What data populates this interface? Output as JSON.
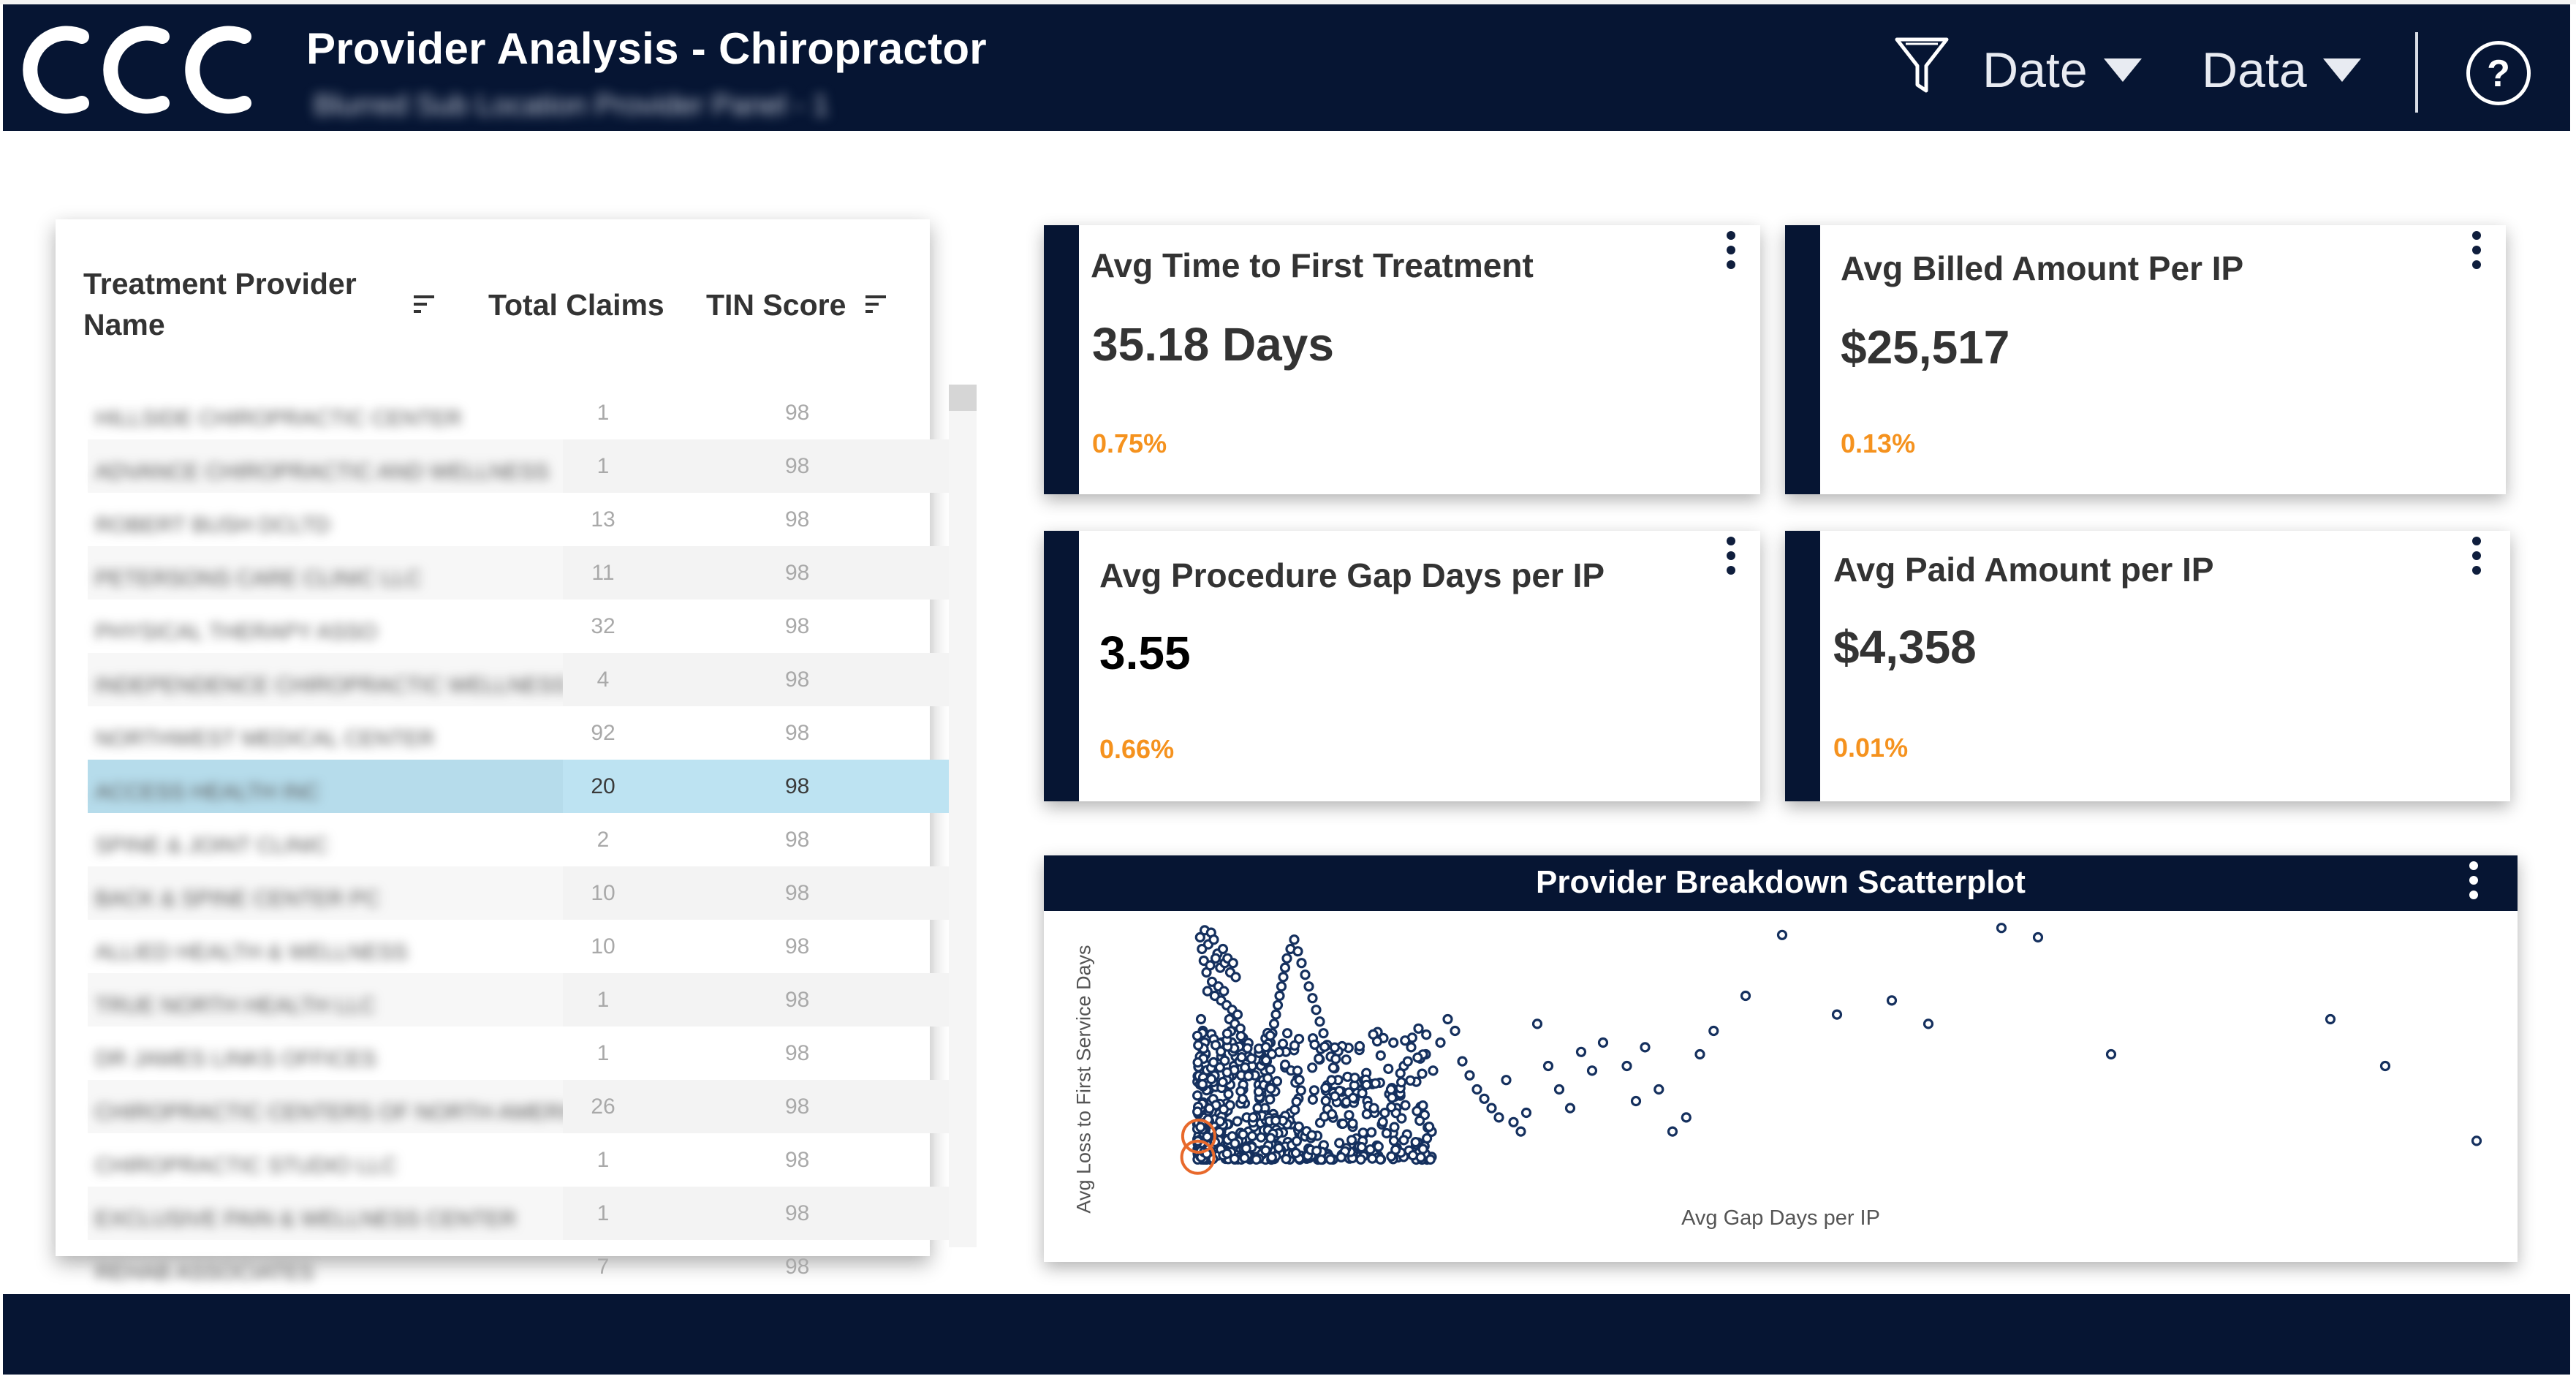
{
  "header": {
    "title": "Provider Analysis - Chiropractor",
    "subtitle": "Blurred Sub Location Provider Panel - 1",
    "date_label": "Date",
    "data_label": "Data",
    "help_label": "?"
  },
  "table": {
    "col_name": [
      "Treatment Provider",
      "Name"
    ],
    "col_claims": "Total Claims",
    "col_tin": "TIN Score",
    "rows": [
      {
        "name": "HILLSIDE CHIROPRACTIC CENTER",
        "claims": "1",
        "tin": "98"
      },
      {
        "name": "ADVANCE CHIROPRACTIC AND WELLNESS",
        "claims": "1",
        "tin": "98"
      },
      {
        "name": "ROBERT BUSH DCLTD",
        "claims": "13",
        "tin": "98"
      },
      {
        "name": "PETERSONS CARE CLINIC LLC",
        "claims": "11",
        "tin": "98"
      },
      {
        "name": "PHYSICAL THERAPY ASSO",
        "claims": "32",
        "tin": "98"
      },
      {
        "name": "INDEPENDENCE CHIROPRACTIC WELLNESS",
        "claims": "4",
        "tin": "98"
      },
      {
        "name": "NORTHWEST MEDICAL CENTER",
        "claims": "92",
        "tin": "98"
      },
      {
        "name": "ACCESS HEALTH INC",
        "claims": "20",
        "tin": "98"
      },
      {
        "name": "SPINE & JOINT CLINIC",
        "claims": "2",
        "tin": "98"
      },
      {
        "name": "BACK & SPINE CENTER PC",
        "claims": "10",
        "tin": "98"
      },
      {
        "name": "ALLIED HEALTH & WELLNESS",
        "claims": "10",
        "tin": "98"
      },
      {
        "name": "TRUE NORTH HEALTH LLC",
        "claims": "1",
        "tin": "98"
      },
      {
        "name": "DR JAMES LINKS OFFICES",
        "claims": "1",
        "tin": "98"
      },
      {
        "name": "CHIROPRACTIC CENTERS OF NORTH AMERICA INC",
        "claims": "26",
        "tin": "98"
      },
      {
        "name": "CHIROPRACTIC STUDIO LLC",
        "claims": "1",
        "tin": "98"
      },
      {
        "name": "EXCLUSIVE PAIN & WELLNESS CENTER",
        "claims": "1",
        "tin": "98"
      },
      {
        "name": "REHAB ASSOCIATES",
        "claims": "7",
        "tin": "98"
      }
    ]
  },
  "kpis": [
    {
      "title": "Avg Time to First Treatment",
      "value": "35.18 Days",
      "delta": "0.75%"
    },
    {
      "title": "Avg Billed Amount Per IP",
      "value": "$25,517",
      "delta": "0.13%"
    },
    {
      "title": "Avg Procedure Gap Days per IP",
      "value": "3.55",
      "delta": "0.66%"
    },
    {
      "title": "Avg Paid Amount per IP",
      "value": "$4,358",
      "delta": "0.01%"
    }
  ],
  "chart_data": {
    "type": "scatter",
    "title": "Provider Breakdown Scatterplot",
    "xlabel": "Avg Gap Days per IP",
    "ylabel": "Avg Loss to First Service Days",
    "xlim": [
      0,
      100
    ],
    "ylim": [
      0,
      100
    ],
    "grid": false,
    "colors": {
      "points": "#15305e",
      "highlight": "#e8692b"
    },
    "highlighted": [
      [
        0.5,
        1
      ],
      [
        1.5,
        10
      ]
    ],
    "points": [
      [
        3,
        95
      ],
      [
        8,
        98
      ],
      [
        12,
        92
      ],
      [
        5,
        90
      ],
      [
        15,
        97
      ],
      [
        18,
        94
      ],
      [
        22,
        88
      ],
      [
        7,
        85
      ],
      [
        10,
        80
      ],
      [
        14,
        83
      ],
      [
        20,
        86
      ],
      [
        25,
        82
      ],
      [
        28,
        90
      ],
      [
        30,
        84
      ],
      [
        33,
        86
      ],
      [
        36,
        80
      ],
      [
        39,
        84
      ],
      [
        42,
        78
      ],
      [
        11,
        72
      ],
      [
        16,
        76
      ],
      [
        19,
        70
      ],
      [
        23,
        74
      ],
      [
        26,
        68
      ],
      [
        29,
        72
      ],
      [
        32,
        66
      ],
      [
        35,
        60
      ],
      [
        38,
        64
      ],
      [
        41,
        58
      ],
      [
        44,
        62
      ],
      [
        47,
        56
      ],
      [
        50,
        52
      ],
      [
        53,
        48
      ],
      [
        56,
        44
      ],
      [
        60,
        40
      ],
      [
        63,
        36
      ],
      [
        67,
        32
      ],
      [
        70,
        28
      ],
      [
        74,
        22
      ],
      [
        77,
        18
      ],
      [
        81,
        14
      ],
      [
        85,
        10
      ],
      [
        88,
        6
      ],
      [
        4,
        60
      ],
      [
        6,
        55
      ],
      [
        8,
        50
      ],
      [
        9,
        45
      ],
      [
        10,
        40
      ],
      [
        12,
        35
      ],
      [
        13,
        30
      ],
      [
        15,
        25
      ],
      [
        17,
        20
      ],
      [
        18,
        15
      ],
      [
        20,
        10
      ],
      [
        22,
        5
      ],
      [
        24,
        8
      ],
      [
        26,
        12
      ],
      [
        28,
        16
      ],
      [
        30,
        20
      ],
      [
        32,
        24
      ],
      [
        34,
        28
      ],
      [
        36,
        32
      ],
      [
        38,
        36
      ],
      [
        40,
        40
      ],
      [
        42,
        44
      ],
      [
        44,
        48
      ],
      [
        46,
        42
      ],
      [
        48,
        36
      ],
      [
        50,
        30
      ],
      [
        52,
        24
      ],
      [
        54,
        18
      ],
      [
        56,
        12
      ],
      [
        58,
        6
      ],
      [
        60,
        10
      ],
      [
        62,
        14
      ],
      [
        64,
        18
      ],
      [
        66,
        22
      ],
      [
        68,
        26
      ],
      [
        70,
        30
      ],
      [
        72,
        34
      ],
      [
        74,
        38
      ],
      [
        76,
        42
      ],
      [
        78,
        46
      ],
      [
        80,
        50
      ],
      [
        82,
        54
      ],
      [
        84,
        58
      ],
      [
        86,
        62
      ],
      [
        88,
        66
      ],
      [
        90,
        70
      ],
      [
        92,
        74
      ],
      [
        94,
        78
      ],
      [
        96,
        82
      ],
      [
        98,
        86
      ],
      [
        102,
        90
      ],
      [
        106,
        94
      ],
      [
        110,
        89
      ],
      [
        114,
        84
      ],
      [
        118,
        79
      ],
      [
        122,
        74
      ],
      [
        126,
        69
      ],
      [
        130,
        64
      ],
      [
        134,
        59
      ],
      [
        138,
        54
      ],
      [
        142,
        49
      ],
      [
        146,
        44
      ],
      [
        150,
        39
      ],
      [
        154,
        34
      ],
      [
        158,
        29
      ],
      [
        162,
        24
      ],
      [
        166,
        19
      ],
      [
        170,
        14
      ],
      [
        174,
        9
      ],
      [
        180,
        30
      ],
      [
        186,
        25
      ],
      [
        194,
        20
      ],
      [
        202,
        15
      ],
      [
        210,
        28
      ],
      [
        218,
        22
      ],
      [
        226,
        40
      ],
      [
        234,
        48
      ],
      [
        242,
        56
      ],
      [
        250,
        45
      ],
      [
        258,
        38
      ],
      [
        266,
        50
      ],
      [
        274,
        60
      ],
      [
        282,
        55
      ],
      [
        290,
        42
      ],
      [
        298,
        36
      ],
      [
        306,
        30
      ],
      [
        314,
        26
      ],
      [
        322,
        22
      ],
      [
        330,
        18
      ],
      [
        338,
        34
      ],
      [
        346,
        16
      ],
      [
        354,
        12
      ],
      [
        360,
        20
      ],
      [
        372,
        58
      ],
      [
        384,
        40
      ],
      [
        396,
        30
      ],
      [
        408,
        22
      ],
      [
        420,
        46
      ],
      [
        432,
        38
      ],
      [
        444,
        50
      ],
      [
        470,
        40
      ],
      [
        480,
        25
      ],
      [
        490,
        48
      ],
      [
        505,
        30
      ],
      [
        520,
        12
      ],
      [
        535,
        18
      ],
      [
        550,
        45
      ],
      [
        565,
        55
      ],
      [
        600,
        70
      ],
      [
        640,
        96
      ],
      [
        700,
        62
      ],
      [
        760,
        68
      ],
      [
        800,
        58
      ],
      [
        880,
        99
      ],
      [
        920,
        95
      ],
      [
        1000,
        45
      ],
      [
        1240,
        60
      ],
      [
        1300,
        40
      ],
      [
        1400,
        8
      ]
    ]
  },
  "icons": {
    "logo": "ccc-logo",
    "filter": "funnel-icon",
    "help": "help-circle-icon",
    "sort": "sort-icon",
    "more": "more-vertical-icon"
  }
}
